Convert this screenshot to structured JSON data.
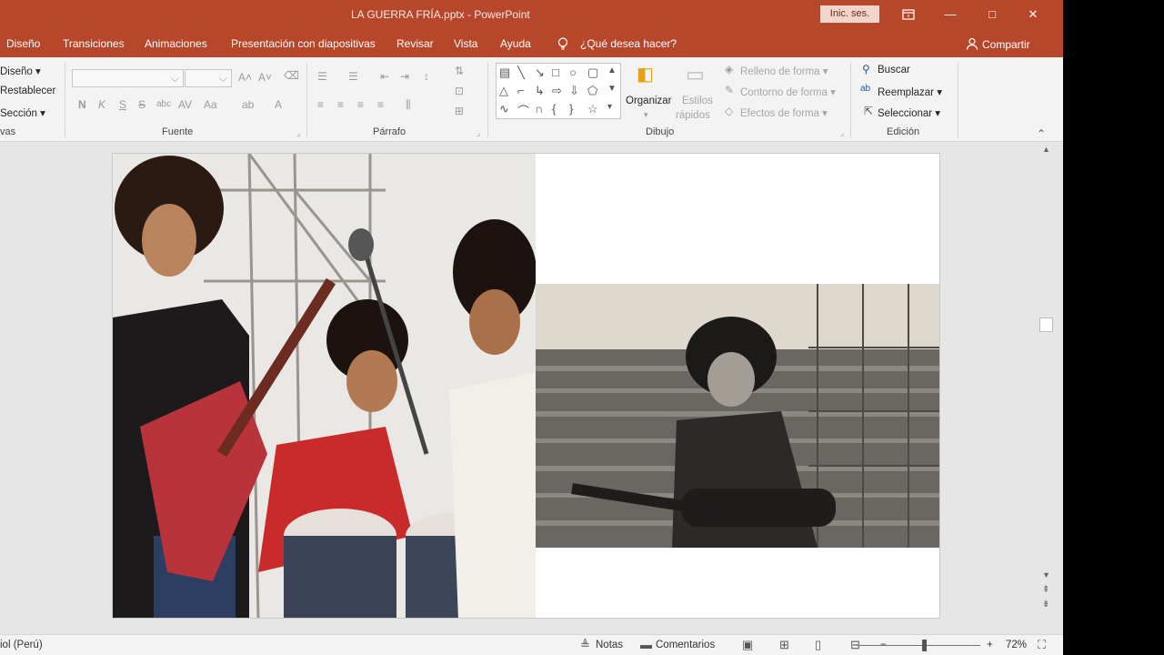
{
  "titlebar": {
    "title": "LA GUERRA FRÍA.pptx  -  PowerPoint",
    "sign_in": "Inic. ses.",
    "restore_ribbon_icon": "ribbon-display-icon",
    "minimize": "—",
    "maximize": "□",
    "close": "✕"
  },
  "tabs": {
    "items": [
      "Diseño",
      "Transiciones",
      "Animaciones",
      "Presentación con diapositivas",
      "Revisar",
      "Vista",
      "Ayuda"
    ],
    "tell_me": "¿Qué desea hacer?",
    "share": "Compartir"
  },
  "ribbon": {
    "slides_group": {
      "layout": "Diseño",
      "reset": "Restablecer",
      "section": "Sección",
      "label": "vas"
    },
    "font_group": {
      "label": "Fuente",
      "bold": "N",
      "italic": "K",
      "underline": "S",
      "strike": "S",
      "shadow": "abc",
      "aa": "Aa",
      "font_color": "A"
    },
    "paragraph_group": {
      "label": "Párrafo"
    },
    "drawing_group": {
      "label": "Dibujo",
      "arrange": "Organizar",
      "quick_styles_1": "Estilos",
      "quick_styles_2": "rápidos",
      "shape_fill": "Relleno de forma",
      "shape_outline": "Contorno de forma",
      "shape_effects": "Efectos de forma"
    },
    "editing_group": {
      "label": "Edición",
      "find": "Buscar",
      "replace": "Reemplazar",
      "select": "Seleccionar"
    }
  },
  "statusbar": {
    "language": "iol (Perú)",
    "notes": "Notas",
    "comments": "Comentarios",
    "zoom": "72%",
    "zoom_level": 0.72,
    "minus": "−",
    "plus": "+"
  }
}
